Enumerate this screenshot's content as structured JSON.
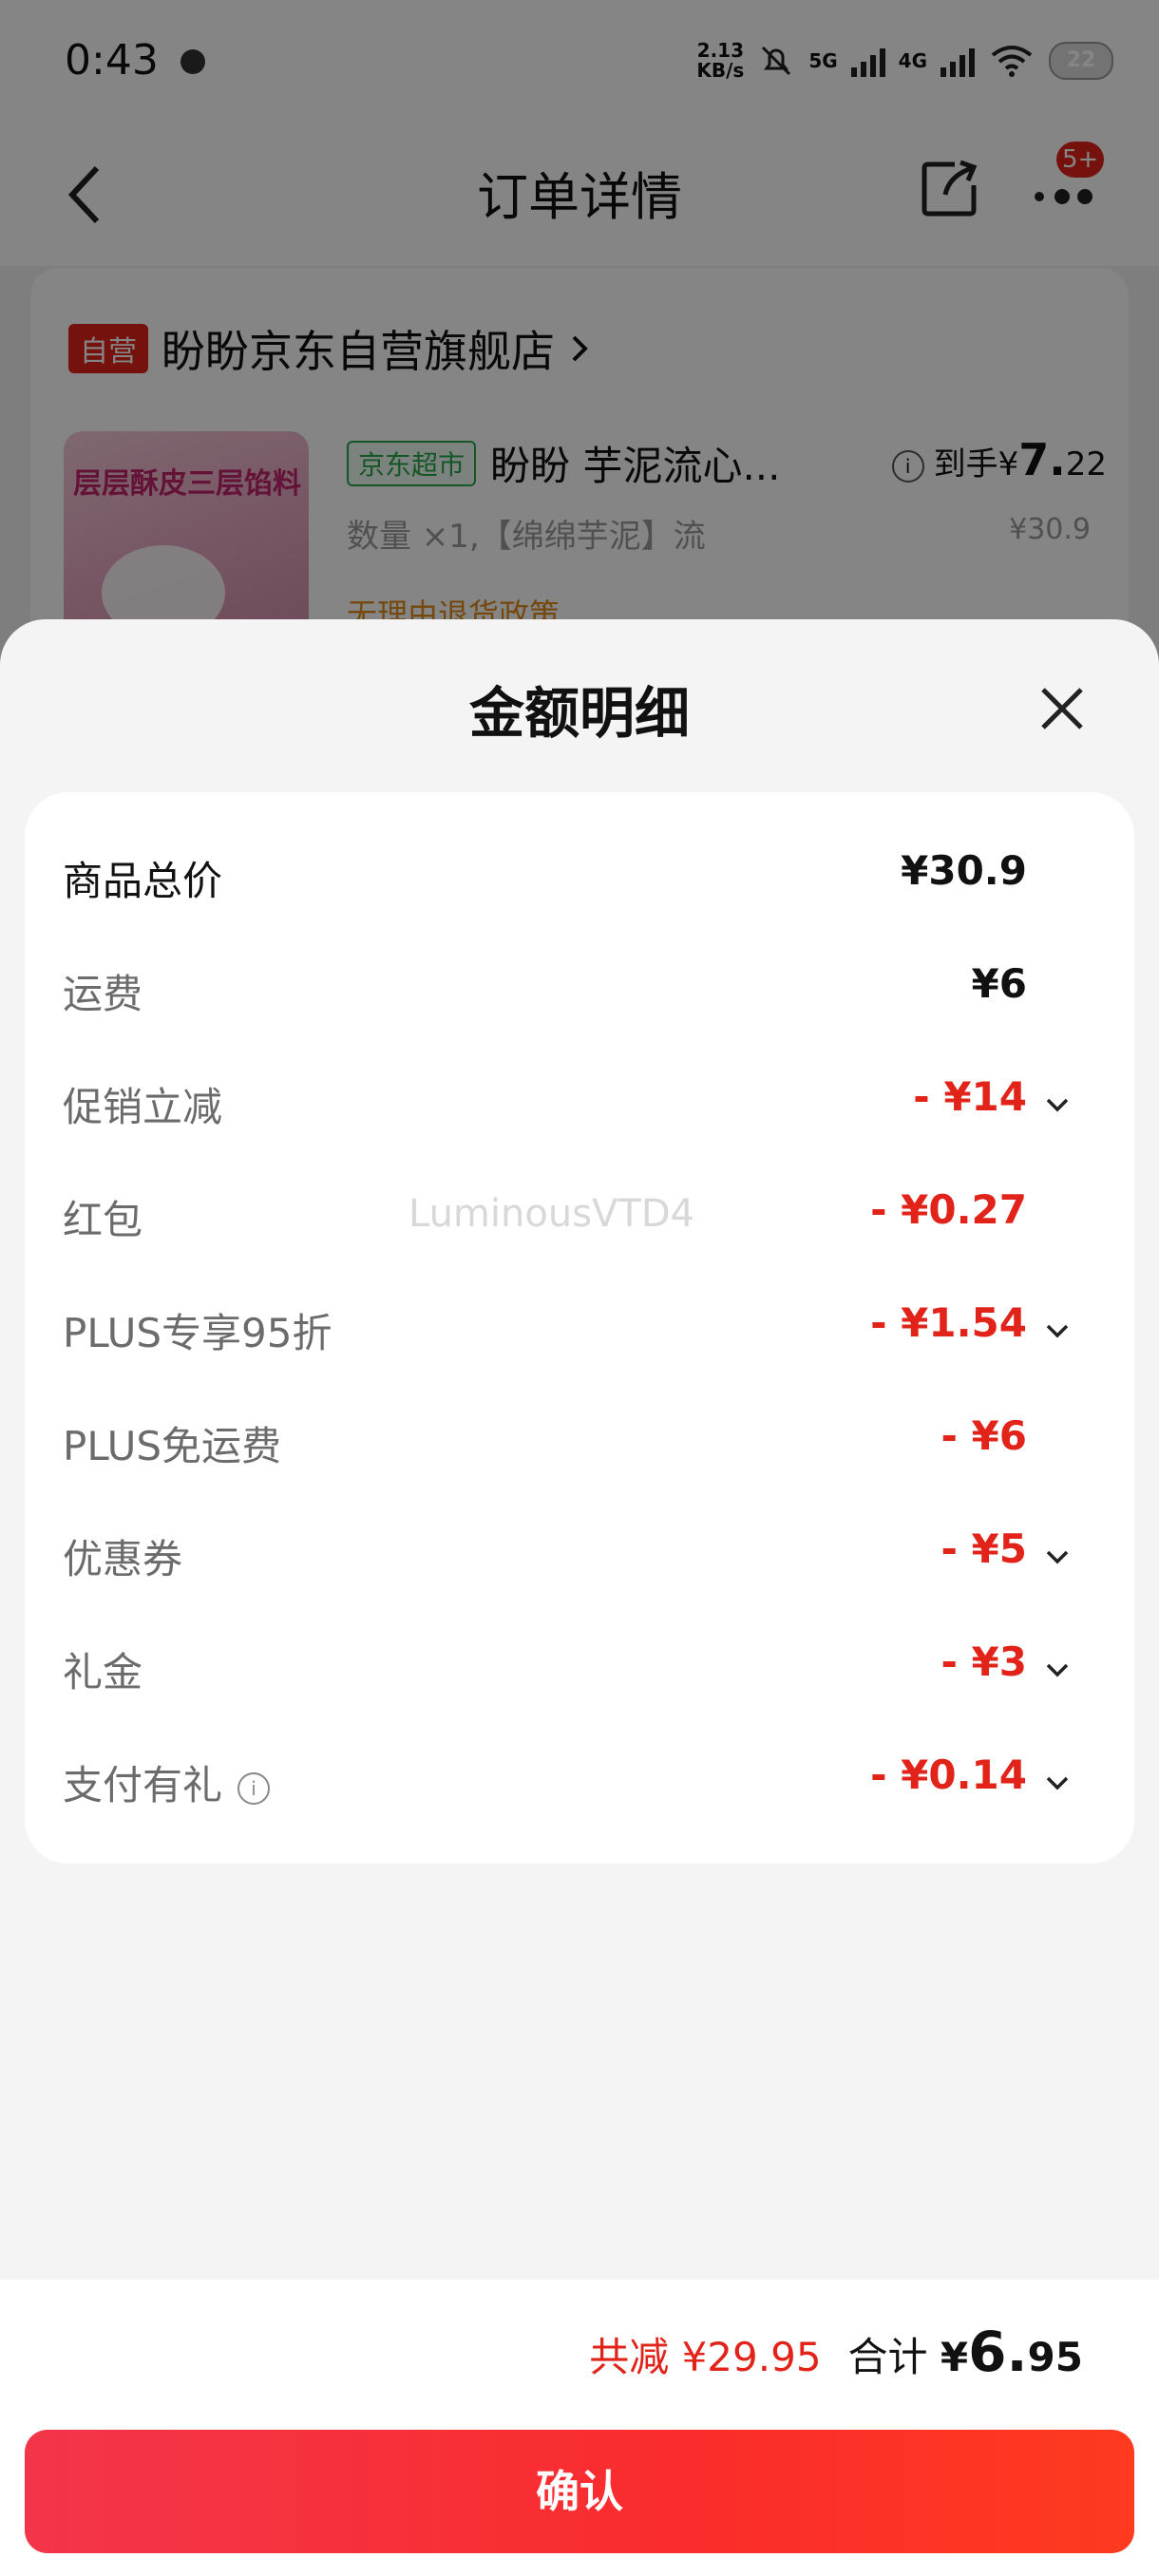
{
  "status_bar": {
    "time": "0:43",
    "speed_value": "2.13",
    "speed_unit": "KB/s",
    "net1": "5G",
    "net2": "4G",
    "battery": "22"
  },
  "top_bar": {
    "title": "订单详情",
    "message_badge": "5+"
  },
  "order": {
    "self_tag": "自营",
    "shop_name": "盼盼京东自营旗舰店",
    "market_tag": "京东超市",
    "product_name": "盼盼 芋泥流心...",
    "price_prefix": "到手¥",
    "price_int": "7.",
    "price_dec": "22",
    "spec": "数量 ×1,【绵绵芋泥】流",
    "original_price": "¥30.9",
    "policy": "无理由退货政策",
    "thumb_text": "层层酥皮三层馅料"
  },
  "sheet": {
    "title": "金额明细",
    "rows": [
      {
        "label": "商品总价",
        "value": "¥30.9"
      },
      {
        "label": "运费",
        "value": "¥6"
      },
      {
        "label": "促销立减",
        "value": "- ¥14"
      },
      {
        "label": "红包",
        "value": "- ¥0.27"
      },
      {
        "label": "PLUS专享95折",
        "value": "- ¥1.54"
      },
      {
        "label": "PLUS免运费",
        "value": "- ¥6"
      },
      {
        "label": "优惠券",
        "value": "- ¥5"
      },
      {
        "label": "礼金",
        "value": "- ¥3"
      },
      {
        "label": "支付有礼",
        "value": "- ¥0.14"
      }
    ],
    "watermark": "LuminousVTD4"
  },
  "footer": {
    "saved": "共减 ¥29.95",
    "total_label": "合计",
    "total_currency": "¥",
    "total_int": "6.",
    "total_dec": "95",
    "confirm_label": "确认"
  },
  "colors": {
    "accent": "#e2231a",
    "overlay": "rgba(0,0,0,0.48)"
  },
  "icons": [
    "back-arrow-icon",
    "share-icon",
    "more-icon",
    "close-icon",
    "chevron-down-icon",
    "info-icon"
  ]
}
